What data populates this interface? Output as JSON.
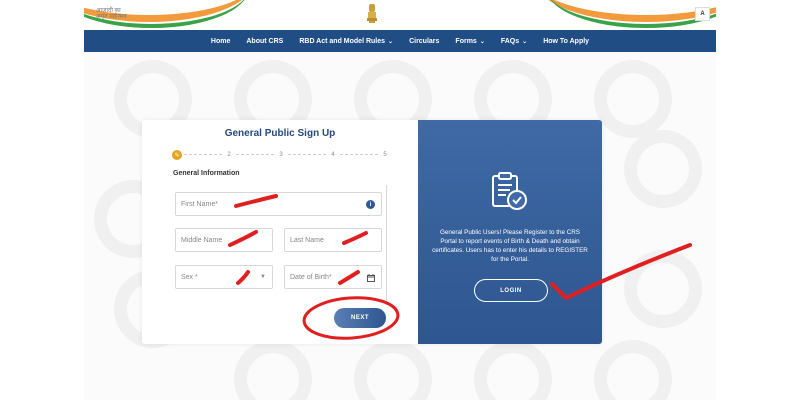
{
  "header": {
    "logo_text": "आज़ादी का अमृत महोत्सव",
    "font_size_button": "A"
  },
  "nav": {
    "items": [
      {
        "label": "Home",
        "has_dropdown": false
      },
      {
        "label": "About CRS",
        "has_dropdown": false
      },
      {
        "label": "RBD Act and Model Rules",
        "has_dropdown": true
      },
      {
        "label": "Circulars",
        "has_dropdown": false
      },
      {
        "label": "Forms",
        "has_dropdown": true
      },
      {
        "label": "FAQs",
        "has_dropdown": true
      },
      {
        "label": "How To Apply",
        "has_dropdown": false
      }
    ]
  },
  "form": {
    "title": "General Public Sign Up",
    "steps": [
      "",
      "2",
      "3",
      "4",
      "5"
    ],
    "active_step_icon": "✎",
    "section_label": "General Information",
    "fields": {
      "first_name": "First Name*",
      "middle_name": "Middle Name",
      "last_name": "Last Name",
      "sex": "Sex *",
      "date_of_birth": "Date of Birth*"
    },
    "next_label": "NEXT"
  },
  "info": {
    "text": "General Public Users! Please Register to the CRS Portal to report events of Birth & Death and obtain certificates. Users has to enter his details to REGISTER for the Portal.",
    "login_label": "LOGIN"
  },
  "colors": {
    "nav_bg": "#214d85",
    "accent": "#e3a420",
    "info_pane": "#2e5690",
    "annotation": "#e02020"
  }
}
